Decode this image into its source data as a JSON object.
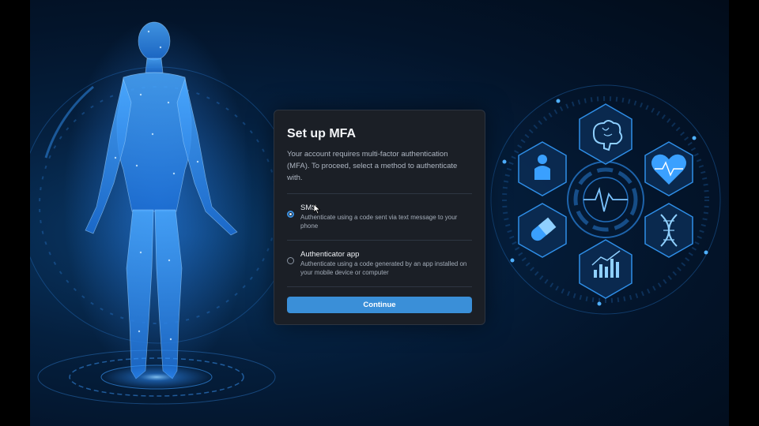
{
  "dialog": {
    "title": "Set up MFA",
    "description": "Your account requires multi-factor authentication (MFA). To proceed, select a method to authenticate with.",
    "options": [
      {
        "label": "SMS",
        "help": "Authenticate using a code sent via text message to your phone",
        "selected": true
      },
      {
        "label": "Authenticator app",
        "help": "Authenticate using a code generated by an app installed on your mobile device or computer",
        "selected": false
      }
    ],
    "continue_label": "Continue"
  },
  "background": {
    "icons": [
      "brain-icon",
      "heart-icon",
      "dna-icon",
      "chart-icon",
      "pill-icon",
      "person-icon",
      "pulse-icon"
    ]
  },
  "colors": {
    "accent": "#3a8fd8",
    "dialog_bg": "#1b1f26",
    "glow": "#3aa0ff"
  }
}
